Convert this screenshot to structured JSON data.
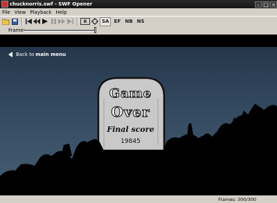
{
  "window": {
    "title": "chucknorris.swf - SWF Opener"
  },
  "menu": {
    "items": [
      "File",
      "View",
      "Playback",
      "Help"
    ]
  },
  "toolbar": {
    "text_buttons": {
      "box": "B",
      "sa": "SA",
      "ef": "EF",
      "nb": "NB",
      "ns": "NS"
    }
  },
  "frame": {
    "label": "Frame:",
    "position_fraction": 1.0
  },
  "stage": {
    "back_prefix": "Back to",
    "back_bold": "main menu",
    "tomb_line1": "Game",
    "tomb_line2": "Over",
    "final_score_label": "Final score",
    "final_score_value": "19845"
  },
  "status": {
    "frames_text": "Frames: 300/300"
  },
  "colors": {
    "title_bar": "#1e1e1e",
    "chrome": "#d4d0c8",
    "sky_top": "#223246",
    "sky_bottom": "#465e72"
  }
}
